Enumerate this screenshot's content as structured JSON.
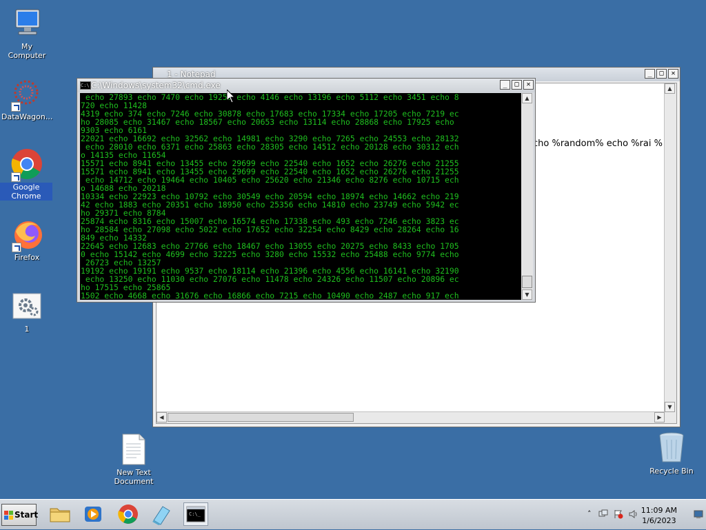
{
  "colors": {
    "desktop": "#3a6ea5",
    "console_text": "#1fbf1f"
  },
  "desktop_icons": [
    {
      "label": "My Computer",
      "icon": "computer-icon"
    },
    {
      "label": "DataWagon...",
      "icon": "datawagon-icon"
    },
    {
      "label": "Google Chrome",
      "icon": "chrome-icon"
    },
    {
      "label": "Firefox",
      "icon": "firefox-icon"
    },
    {
      "label": "1",
      "icon": "settings-file-icon"
    },
    {
      "label": "New Text\nDocument",
      "icon": "text-document-icon"
    },
    {
      "label": "Recycle Bin",
      "icon": "recycle-bin-icon"
    }
  ],
  "notepad": {
    "title": "1 - Notepad",
    "visible_text": "% echo %random% echo %rai"
  },
  "cmd": {
    "title": "C:\\Windows\\system32\\cmd.exe",
    "lines": [
      " echo 27893 echo 7470 echo 19251 echo 4146 echo 13196 echo 5112 echo 3451 echo 8",
      "720 echo 11428",
      "4319 echo 374 echo 7246 echo 30878 echo 17683 echo 17334 echo 17205 echo 7219 ec",
      "ho 28085 echo 31467 echo 18567 echo 20653 echo 13114 echo 28868 echo 17925 echo",
      "9303 echo 6161",
      "22021 echo 16692 echo 32562 echo 14981 echo 3290 echo 7265 echo 24553 echo 28132",
      " echo 28010 echo 6371 echo 25863 echo 28305 echo 14512 echo 20128 echo 30312 ech",
      "o 14135 echo 11654",
      "15571 echo 8941 echo 13455 echo 29699 echo 22540 echo 1652 echo 26276 echo 21255",
      "15571 echo 8941 echo 13455 echo 29699 echo 22540 echo 1652 echo 26276 echo 21255",
      " echo 14712 echo 19464 echo 10405 echo 25620 echo 21346 echo 8276 echo 10715 ech",
      "o 14688 echo 20218",
      "10334 echo 22923 echo 10792 echo 30549 echo 20594 echo 18974 echo 14662 echo 219",
      "42 echo 1883 echo 20351 echo 18950 echo 25356 echo 14810 echo 23749 echo 5942 ec",
      "ho 29371 echo 8784",
      "25874 echo 8316 echo 15007 echo 16574 echo 17338 echo 493 echo 7246 echo 3823 ec",
      "ho 28584 echo 27098 echo 5022 echo 17652 echo 32254 echo 8429 echo 28264 echo 16",
      "849 echo 14332",
      "22645 echo 12683 echo 27766 echo 18467 echo 13055 echo 20275 echo 8433 echo 1705",
      "0 echo 15142 echo 4699 echo 32225 echo 3280 echo 15532 echo 25488 echo 9774 echo",
      " 26723 echo 13257",
      "19192 echo 19191 echo 9537 echo 18114 echo 21396 echo 4556 echo 16141 echo 32190",
      " echo 13250 echo 11030 echo 27076 echo 11478 echo 24326 echo 11507 echo 20896 ec",
      "ho 17515 echo 25865",
      "1502 echo 4668 echo 31676 echo 16866 echo 7215 echo 10490 echo 2487 echo 917 ech"
    ]
  },
  "window_buttons": {
    "minimize": "_",
    "maximize": "□",
    "close": "✕"
  },
  "taskbar": {
    "start_label": "Start",
    "clock_time": "11:09 AM",
    "clock_date": "1/6/2023"
  }
}
